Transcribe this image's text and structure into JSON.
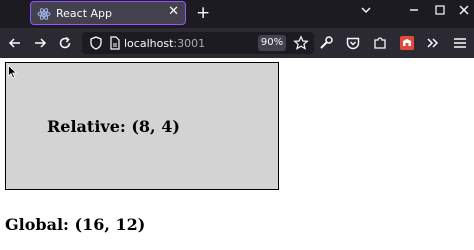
{
  "browser": {
    "tab": {
      "title": "React App",
      "close_glyph": "✕",
      "favicon": "react-icon",
      "accent_color": "#9059ff"
    },
    "new_tab_glyph": "+",
    "window_controls": {
      "chevron": "⌄",
      "minimize": "–",
      "maximize": "☐",
      "close": "✕"
    },
    "url": {
      "host": "localhost",
      "port": ":3001"
    },
    "zoom_label": "90%",
    "icons": [
      "back-icon",
      "forward-icon",
      "reload-icon",
      "shield-icon",
      "page-icon",
      "star-icon",
      "wrench-icon",
      "pocket-icon",
      "extensions-icon",
      "addon-icon",
      "overflow-icon",
      "menu-icon"
    ]
  },
  "page": {
    "relative_label": "Relative: (8, 4)",
    "global_label": "Global: (16, 12)",
    "box_color": "#d3d3d3"
  }
}
